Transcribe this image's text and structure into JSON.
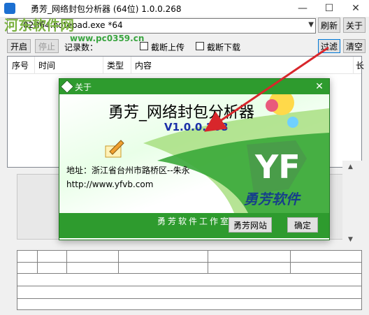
{
  "window": {
    "title": "勇芳_网络封包分析器 (64位) 1.0.0.268",
    "minimize_glyph": "—",
    "maximize_glyph": "☐",
    "close_glyph": "✕"
  },
  "watermark": {
    "site_name": "河东软件网",
    "url": "www.pc0359.cn"
  },
  "toolbar": {
    "process_value": "02B64:notepad.exe *64",
    "refresh_label": "刷新",
    "close_label": "关于",
    "start_label": "开启",
    "stop_label": "停止",
    "record_count_label": "记录数：",
    "block_upload_label": "截断上传",
    "block_download_label": "截断下载",
    "filter_label": "过滤",
    "clear_label": "清空"
  },
  "list": {
    "columns": [
      "序号",
      "时间",
      "类型",
      "内容",
      "长"
    ]
  },
  "about_dialog": {
    "title": "关于",
    "app_name": "勇芳_网络封包分析器",
    "version": "V1.0.0.268",
    "address": "地址：浙江省台州市路桥区--朱永",
    "url": "http://www.yfvb.com",
    "studio": "勇芳软件工作室",
    "brand": "勇芳软件",
    "website_button": "勇芳网站",
    "ok_button": "确定"
  },
  "colors": {
    "dialog_green": "#2e9b2e",
    "version_blue": "#1b2fa8",
    "arrow_red": "#d8262b"
  }
}
